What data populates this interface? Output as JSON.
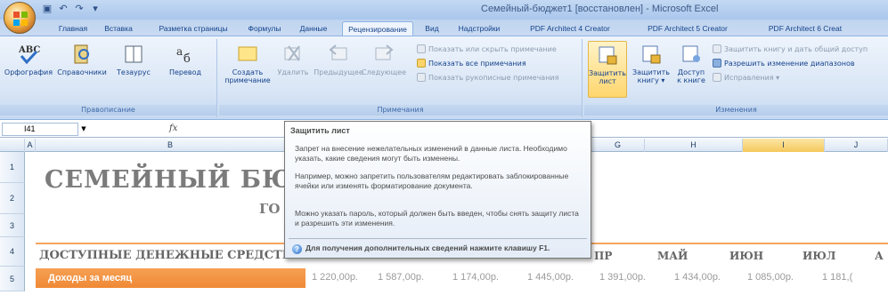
{
  "window": {
    "title": "Семейный-бюджет1 [восстановлен] - Microsoft Excel"
  },
  "tabs": [
    {
      "label": "Главная"
    },
    {
      "label": "Вставка"
    },
    {
      "label": "Разметка страницы"
    },
    {
      "label": "Формулы"
    },
    {
      "label": "Данные"
    },
    {
      "label": "Рецензирование",
      "active": true
    },
    {
      "label": "Вид"
    },
    {
      "label": "Надстройки"
    },
    {
      "label": "PDF Architect 4 Creator"
    },
    {
      "label": "PDF Architect 5 Creator"
    },
    {
      "label": "PDF Architect 6 Creat"
    }
  ],
  "ribbon": {
    "proofing": {
      "label": "Правописание",
      "spelling": "Орфография",
      "references": "Справочники",
      "thesaurus": "Тезаурус",
      "translate": "Перевод"
    },
    "comments": {
      "label": "Примечания",
      "create_line1": "Создать",
      "create_line2": "примечание",
      "delete": "Удалить",
      "previous": "Предыдущее",
      "next": "Следующее",
      "show_hide": "Показать или скрыть примечание",
      "show_all": "Показать все примечания",
      "show_ink": "Показать рукописные примечания"
    },
    "changes": {
      "label": "Изменения",
      "protect_sheet_line1": "Защитить",
      "protect_sheet_line2": "лист",
      "protect_book_line1": "Защитить",
      "protect_book_line2": "книгу",
      "share_line1": "Доступ",
      "share_line2": "к книге",
      "protect_share": "Защитить книгу и дать общий доступ",
      "allow_ranges": "Разрешить изменение диапазонов",
      "track_changes": "Исправления"
    }
  },
  "formula_bar": {
    "name_box": "I41",
    "fx": "fx"
  },
  "columns": [
    "A",
    "B",
    "G",
    "H",
    "I",
    "J"
  ],
  "rows": [
    "1",
    "2",
    "3",
    "4",
    "5"
  ],
  "sheet": {
    "title": "СЕМЕЙНЫЙ БЮД",
    "year_fragment": "ГО",
    "section": "ДОСТУПНЫЕ ДЕНЕЖНЫЕ СРЕДСТВ",
    "months": [
      "ПР",
      "МАЙ",
      "ИЮН",
      "ИЮЛ",
      "А"
    ],
    "income_label": "Доходы за месяц",
    "income_values": [
      "1 220,00р.",
      "1 587,00р.",
      "1 174,00р.",
      "1 445,00р.",
      "1 391,00р.",
      "1 434,00р.",
      "1 085,00р.",
      "1 181,("
    ]
  },
  "tooltip": {
    "title": "Защитить лист",
    "p1": "Запрет на внесение нежелательных изменений в данные листа. Необходимо указать, какие сведения могут быть изменены.",
    "p2": "Например, можно запретить пользователям редактировать заблокированные ячейки или изменять форматирование документа.",
    "p3": "Можно указать пароль, который должен быть введен, чтобы снять защиту листа и разрешить эти изменения.",
    "help": "Для получения дополнительных сведений нажмите клавишу F1."
  },
  "colors": {
    "accent_orange": "#ef8a36",
    "ribbon_blue": "#dbe7f6",
    "selected_col": "#f5c85c"
  }
}
